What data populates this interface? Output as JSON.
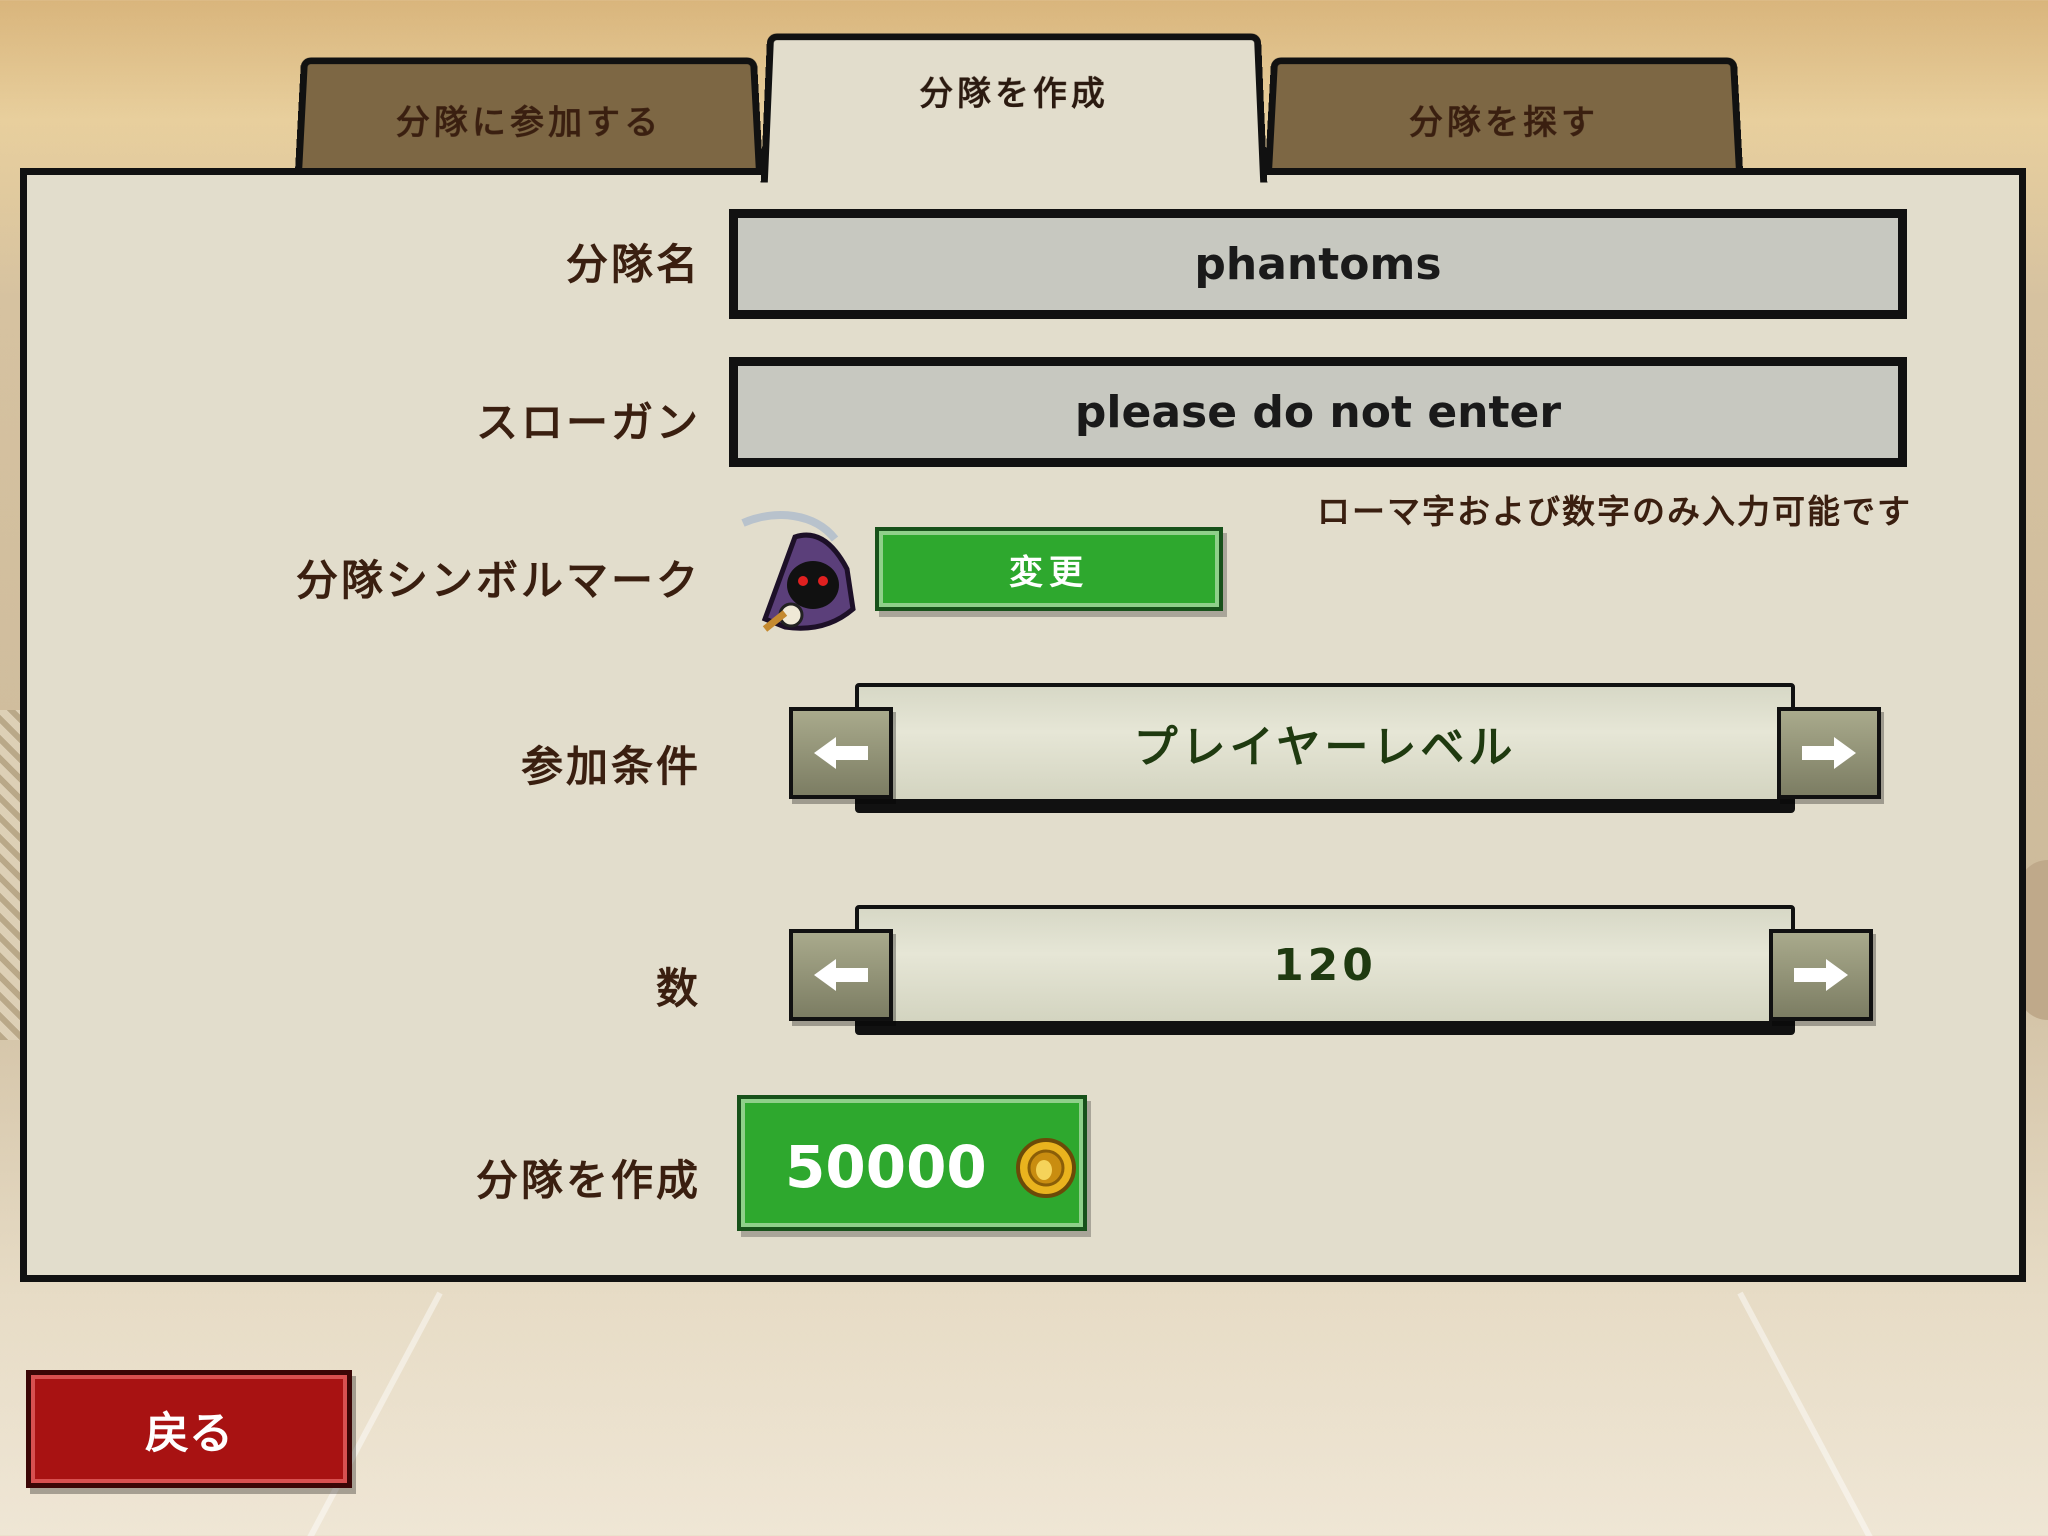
{
  "tabs": [
    {
      "label": "分隊に参加する",
      "active": false
    },
    {
      "label": "分隊を作成",
      "active": true
    },
    {
      "label": "分隊を探す",
      "active": false
    }
  ],
  "form": {
    "name_label": "分隊名",
    "name_value": "phantoms",
    "slogan_label": "スローガン",
    "slogan_value": "please do not enter",
    "hint": "ローマ字および数字のみ入力可能です",
    "emblem_label": "分隊シンボルマーク",
    "emblem_icon": "hooded-reaper-icon",
    "change_label": "変更",
    "condition_label": "参加条件",
    "condition_value": "プレイヤーレベル",
    "number_label": "数",
    "number_value": "120",
    "create_label": "分隊を作成",
    "cost_value": "50000",
    "cost_icon": "gold-coin-icon"
  },
  "back_label": "戻る",
  "colors": {
    "panel": "#e2ddcc",
    "tab_inactive": "#7d6744",
    "green_button": "#2ea82e",
    "back_button": "#a81212",
    "field": "#c7c8c0"
  }
}
